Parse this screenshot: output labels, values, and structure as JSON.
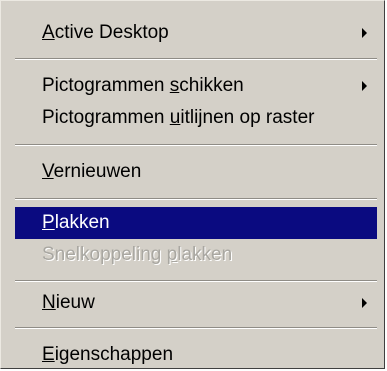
{
  "menu": {
    "items": [
      {
        "before": "",
        "mnemonic": "A",
        "after": "ctive Desktop",
        "submenu": true,
        "state": "normal"
      },
      {
        "before": "Pictogrammen ",
        "mnemonic": "s",
        "after": "chikken",
        "submenu": true,
        "state": "normal"
      },
      {
        "before": "Pictogrammen ",
        "mnemonic": "u",
        "after": "itlijnen op raster",
        "submenu": false,
        "state": "normal"
      },
      {
        "before": "",
        "mnemonic": "V",
        "after": "ernieuwen",
        "submenu": false,
        "state": "normal"
      },
      {
        "before": "",
        "mnemonic": "P",
        "after": "lakken",
        "submenu": false,
        "state": "selected"
      },
      {
        "before": "Snelkoppeling ",
        "mnemonic": "p",
        "after": "lakken",
        "submenu": false,
        "state": "disabled"
      },
      {
        "before": "",
        "mnemonic": "N",
        "after": "ieuw",
        "submenu": true,
        "state": "normal"
      },
      {
        "before": "",
        "mnemonic": "E",
        "after": "igenschappen",
        "submenu": false,
        "state": "normal"
      }
    ]
  },
  "colors": {
    "menu_background": "#d4d0c8",
    "selection_background": "#0a0a80",
    "selection_text": "#ffffff",
    "disabled_text": "#a9a7a1"
  },
  "icons": {
    "submenu": "submenu-arrow-icon"
  }
}
